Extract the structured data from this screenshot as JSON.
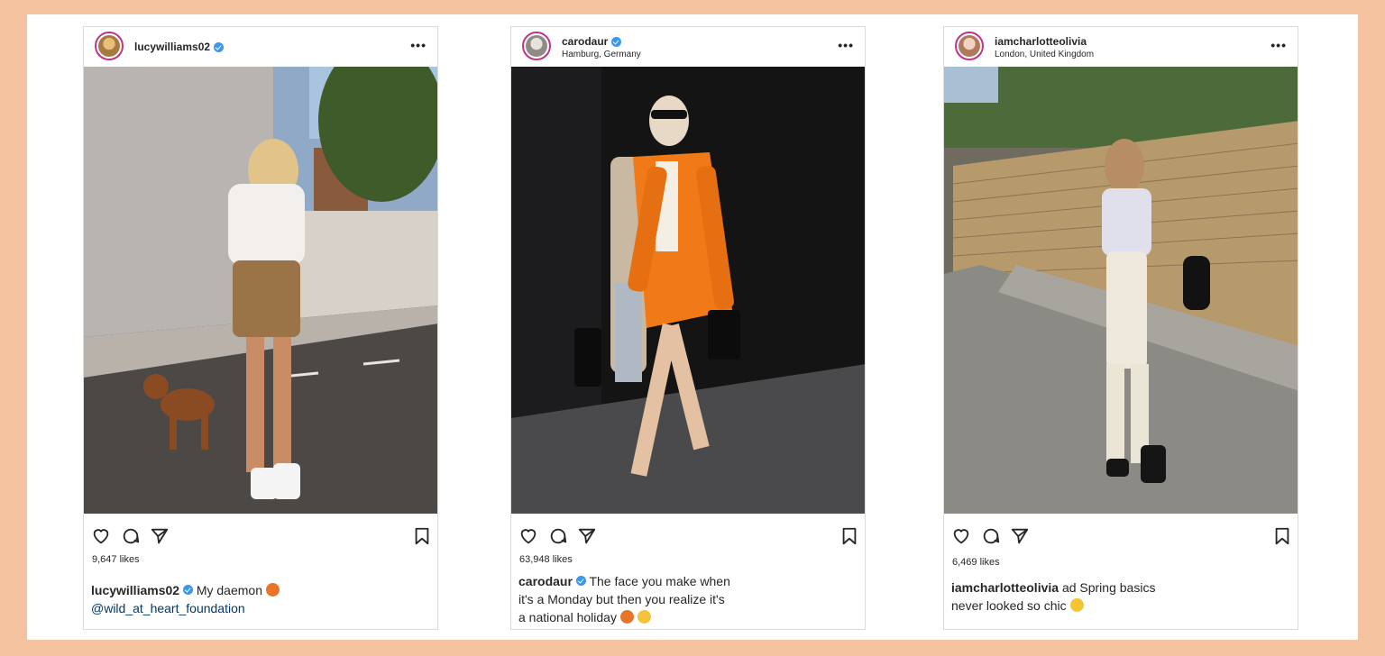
{
  "posts": [
    {
      "username": "lucywilliams02",
      "location": "",
      "likes": "9,647 likes",
      "caption_user": "lucywilliams02",
      "caption_lines": [
        "My daemon"
      ],
      "mention": "@wild_at_heart_foundation"
    },
    {
      "username": "carodaur",
      "location": "Hamburg, Germany",
      "likes": "63,948 likes",
      "caption_user": "carodaur",
      "caption_lines": [
        "The face you make when",
        "it's a Monday but then you realize it's",
        "a national holiday"
      ],
      "mention": ""
    },
    {
      "username": "iamcharlotteolivia",
      "location": "London, United Kingdom",
      "likes": "6,469 likes",
      "caption_user": "iamcharlotteolivia",
      "caption_lines": [
        "ad Spring basics",
        "never looked so chic"
      ],
      "mention": ""
    }
  ],
  "icons": [
    "heart-icon",
    "comment-icon",
    "share-icon",
    "bookmark-icon",
    "more-icon",
    "verified-badge-icon"
  ],
  "colors": {
    "frame": "#f6c3a0",
    "verified": "#3897f0",
    "text": "#262626",
    "mention": "#00376b"
  }
}
